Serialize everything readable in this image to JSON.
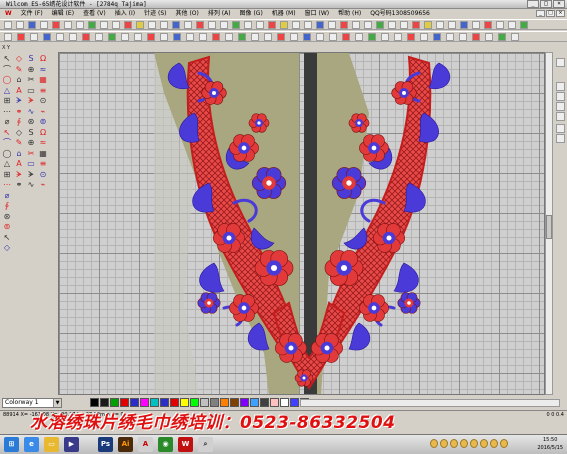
{
  "window": {
    "title": "Wilcom ES-65绣花设计软件 - [2784q            Tajima]",
    "controls": [
      "_",
      "□",
      "×"
    ]
  },
  "menu": {
    "items": [
      "文件 (F)",
      "编辑 (E)",
      "查看 (V)",
      "插入 (I)",
      "针迹 (S)",
      "其他 (O)",
      "排列 (A)",
      "图像 (G)",
      "机器 (M)",
      "窗口 (W)",
      "帮助 (H)",
      "QQ号码1308509656"
    ]
  },
  "coords_label": "X  Y",
  "colorway": {
    "selected": "Colorway 1",
    "swatches": [
      "#000000",
      "#1a1a1a",
      "#00a000",
      "#e00000",
      "#2c2cc8",
      "#ff00ff",
      "#00c0c0",
      "#2c2cc8",
      "#e00000",
      "#ffff00",
      "#00ff00",
      "#c0c0c0",
      "#808080",
      "#ff8000",
      "#804000",
      "#8000ff",
      "#40a0ff",
      "#404040",
      "#ffc0c0",
      "#ffffff",
      "#4040ff",
      "#ff0000"
    ]
  },
  "status": {
    "left": "88914  X=  -161.08  Y=  -90.37  L=  27.22mm  A=  0",
    "right": "0  0  0.4"
  },
  "banner": {
    "text": "水溶绣珠片绣毛巾绣培训：0523-86332504"
  },
  "taskbar": {
    "apps": [
      "start",
      "ie",
      "folder",
      "media",
      "ps",
      "ai",
      "pdf",
      "cdr",
      "wilcom",
      "search"
    ],
    "time": "15:50",
    "date": "2016/5/15"
  },
  "colors": {
    "embroidery_red": "#e23a3a",
    "embroidery_blue": "#4a3ad8",
    "fabric_khaki": "#a8a77f",
    "banner_red": "#e01010"
  }
}
